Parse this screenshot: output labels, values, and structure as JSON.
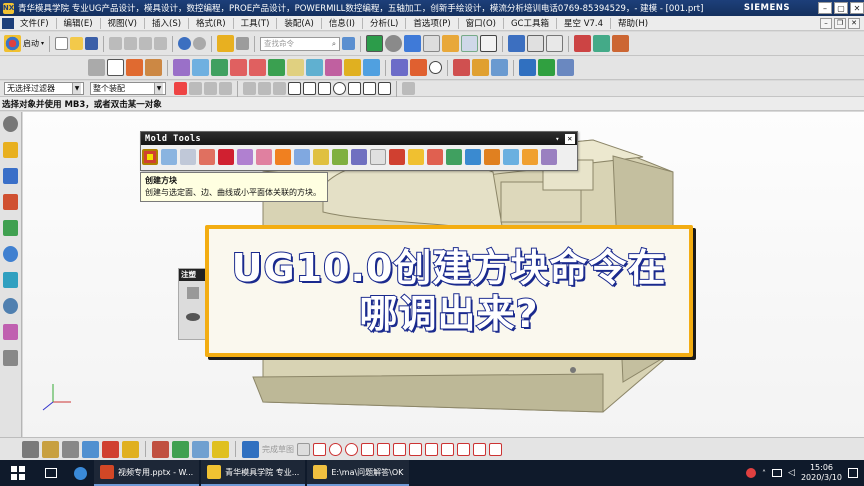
{
  "window": {
    "title": "青华模具学院 专业UG产品设计，模具设计，数控编程，PROE产品设计，POWERMILL数控编程，五轴加工，创新手绘设计，模流分析培训电话0769-85394529，- 建模 - [001.prt]",
    "brand": "SIEMENS"
  },
  "menu": {
    "items": [
      "文件(F)",
      "编辑(E)",
      "视图(V)",
      "插入(S)",
      "格式(R)",
      "工具(T)",
      "装配(A)",
      "信息(I)",
      "分析(L)",
      "首选项(P)",
      "窗口(O)",
      "GC工具箱",
      "星空 V7.4",
      "帮助(H)"
    ]
  },
  "toolbar": {
    "start_label": "启动",
    "search_placeholder": "查找命令"
  },
  "filter": {
    "selection_filter": "无选择过滤器",
    "assembly_scope": "整个装配"
  },
  "status": {
    "prompt": "选择对象并使用 MB3，或者双击某一对象"
  },
  "mold_tools": {
    "title": "Mold Tools",
    "tooltip_title": "创建方块",
    "tooltip_desc": "创建与选定面、边、曲线或小平面体关联的方块。"
  },
  "navigator": {
    "label": "注塑"
  },
  "caption": {
    "line1": "UG10.0创建方块命令在",
    "line2": "哪调出来?"
  },
  "bottom_toolbar": {
    "snap_label": "完成草图"
  },
  "taskbar": {
    "apps": [
      "视频专用.pptx - W...",
      "青华模具学院 专业...",
      "E:\\ma\\问题解答\\OK"
    ],
    "time": "15:06",
    "date": "2020/3/10"
  },
  "colors": {
    "caption_border": "#f3ad12",
    "caption_text_stroke": "#1a2a8e",
    "title_bar": "#1d3f7a",
    "part_body": "#d8d3b4"
  }
}
